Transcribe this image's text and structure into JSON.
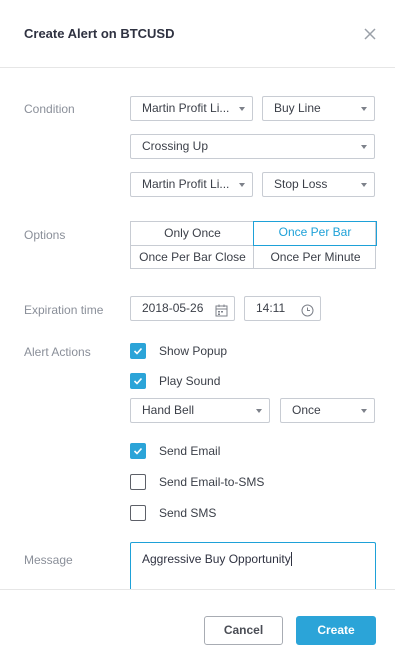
{
  "dialog": {
    "title": "Create Alert on BTCUSD"
  },
  "condition": {
    "label": "Condition",
    "indicator_1": "Martin Profit Li...",
    "line_1": "Buy Line",
    "operator": "Crossing Up",
    "indicator_2": "Martin Profit Li...",
    "line_2": "Stop Loss"
  },
  "options": {
    "label": "Options",
    "items": [
      "Only Once",
      "Once Per Bar",
      "Once Per Bar Close",
      "Once Per Minute"
    ],
    "selected": "Once Per Bar"
  },
  "expiration": {
    "label": "Expiration time",
    "date": "2018-05-26",
    "time": "14:11"
  },
  "alert_actions": {
    "label": "Alert Actions",
    "show_popup": {
      "label": "Show Popup",
      "checked": true
    },
    "play_sound": {
      "label": "Play Sound",
      "checked": true
    },
    "sound": "Hand Bell",
    "sound_repeat": "Once",
    "send_email": {
      "label": "Send Email",
      "checked": true
    },
    "send_email_sms": {
      "label": "Send Email-to-SMS",
      "checked": false
    },
    "send_sms": {
      "label": "Send SMS",
      "checked": false
    }
  },
  "message": {
    "label": "Message",
    "value": "Aggressive Buy Opportunity"
  },
  "buttons": {
    "cancel": "Cancel",
    "create": "Create"
  },
  "colors": {
    "accent": "#2ba4d8",
    "border": "#c8ccd3",
    "label": "#8a8f99"
  }
}
